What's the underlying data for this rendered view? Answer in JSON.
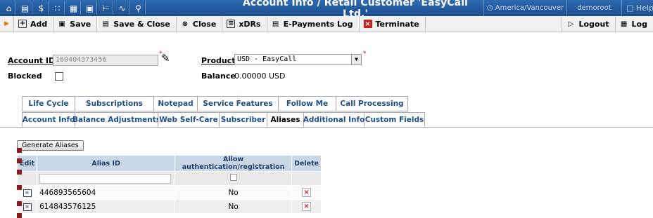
{
  "titlebar": {
    "title": "Account Info / Retail Customer 'EasyCall Ltd.'",
    "timezone": "America/Vancouver",
    "user": "demoroot",
    "help": "Help",
    "icons": [
      "home-icon",
      "menu-icon",
      "billing-icon",
      "grid-icon",
      "users-icon",
      "document-icon",
      "tree-icon",
      "chart-icon",
      "search-icon"
    ]
  },
  "toolbar": {
    "add": "Add",
    "save": "Save",
    "save_close": "Save & Close",
    "close": "Close",
    "xdrs": "xDRs",
    "epayments": "E-Payments Log",
    "terminate": "Terminate",
    "logout": "Logout",
    "log": "Log"
  },
  "form": {
    "account_id_label": "Account ID",
    "account_id_value": "160404373456",
    "product_label": "Product",
    "product_value": "USD - EasyCall",
    "blocked_label": "Blocked",
    "balance_label": "Balance",
    "balance_value": "0.00000 USD"
  },
  "tabs_row1": [
    "Life Cycle",
    "Subscriptions",
    "Notepad",
    "Service Features",
    "Follow Me",
    "Call Processing"
  ],
  "tabs_row2": [
    "Account Info",
    "Balance Adjustments",
    "Web Self-Care",
    "Subscriber",
    "Aliases",
    "Additional Info",
    "Custom Fields"
  ],
  "active_tab": "Aliases",
  "aliases": {
    "generate_button": "Generate Aliases",
    "columns": {
      "edit": "Edit",
      "alias_id": "Alias ID",
      "allow_auth": "Allow authentication/registration",
      "delete": "Delete"
    },
    "rows": [
      {
        "alias_id": "446893565604",
        "allow_auth": "No"
      },
      {
        "alias_id": "614843576125",
        "allow_auth": "No"
      }
    ]
  }
}
